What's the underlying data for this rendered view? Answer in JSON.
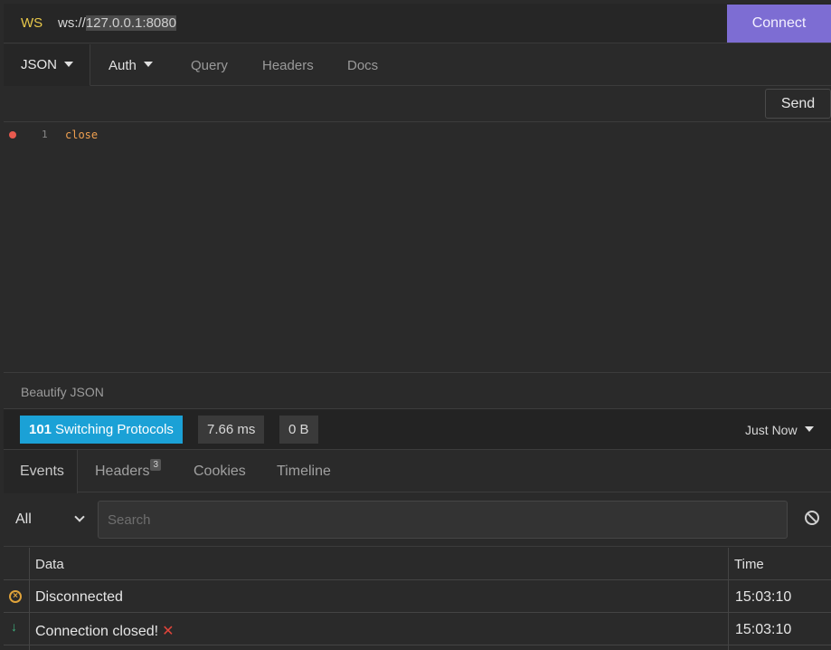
{
  "url_bar": {
    "method": "WS",
    "scheme": "ws://",
    "host": "127.0.0.1:8080",
    "connect_label": "Connect"
  },
  "request_tabs": [
    {
      "label": "JSON"
    },
    {
      "label": "Auth"
    },
    {
      "label": "Query"
    },
    {
      "label": "Headers"
    },
    {
      "label": "Docs"
    }
  ],
  "send_label": "Send",
  "editor": {
    "line_number": "1",
    "code": "close"
  },
  "beautify_label": "Beautify JSON",
  "status": {
    "code": "101",
    "text": "Switching Protocols",
    "time": "7.66 ms",
    "size": "0 B",
    "when": "Just Now"
  },
  "response_tabs": [
    {
      "label": "Events"
    },
    {
      "label": "Headers",
      "badge": "3"
    },
    {
      "label": "Cookies"
    },
    {
      "label": "Timeline"
    }
  ],
  "filter": {
    "selected": "All",
    "search_placeholder": "Search"
  },
  "table": {
    "columns": [
      "Data",
      "Time"
    ],
    "rows": [
      {
        "icon": "x-circle-icon",
        "data": "Disconnected",
        "time": "15:03:10"
      },
      {
        "icon": "arrow-down-icon",
        "data": "Connection closed!",
        "suffix": "✕",
        "time": "15:03:10"
      }
    ]
  },
  "colors": {
    "connect": "#7d6dd3",
    "status_ok": "#1ba1d6",
    "method": "#e8c84a",
    "warn": "#e0a33a",
    "received": "#3fb27f",
    "error": "#e0443a"
  }
}
